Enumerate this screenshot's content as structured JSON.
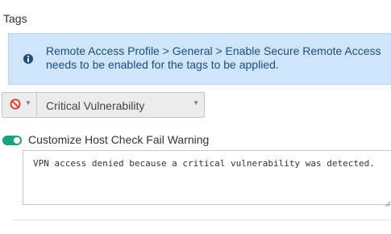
{
  "section": {
    "title": "Tags"
  },
  "info": {
    "icon": "info-circle-icon",
    "line1": "Remote Access Profile > General > Enable Secure Remote Access",
    "line2": "needs to be enabled for the tags to be applied."
  },
  "tag": {
    "icon": "ban-icon",
    "value": "Critical Vulnerability"
  },
  "customize": {
    "label": "Customize Host Check Fail Warning",
    "enabled": true,
    "message": "VPN access denied because a critical vulnerability was detected."
  },
  "colors": {
    "info_bg": "#cfe5fb",
    "info_text": "#1c4e7f",
    "ban_red": "#e0352b",
    "toggle_on": "#16a57a"
  }
}
